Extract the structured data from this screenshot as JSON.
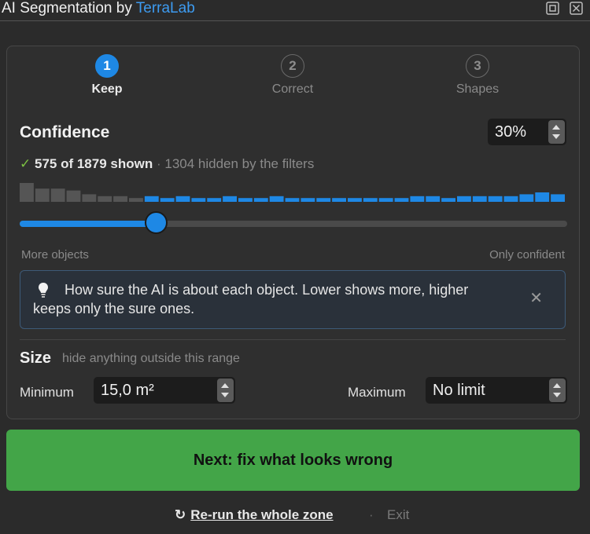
{
  "window": {
    "title_prefix": "AI Segmentation by ",
    "title_brand": "TerraLab"
  },
  "steps": [
    {
      "number": "1",
      "label": "Keep",
      "active": true
    },
    {
      "number": "2",
      "label": "Correct",
      "active": false
    },
    {
      "number": "3",
      "label": "Shapes",
      "active": false
    }
  ],
  "confidence": {
    "title": "Confidence",
    "value": "30%",
    "check": "✓",
    "shown": "575 of 1879 shown",
    "separator": "·",
    "hidden": "1304 hidden by the filters",
    "slider_fraction": 0.25,
    "min_label": "More objects",
    "max_label": "Only confident",
    "histogram": {
      "bins": [
        10,
        7,
        7,
        6,
        4,
        3,
        3,
        2,
        3,
        2,
        3,
        2,
        2,
        3,
        2,
        2,
        3,
        2,
        2,
        2,
        2,
        2,
        2,
        2,
        2,
        3,
        3,
        2,
        3,
        3,
        3,
        3,
        4,
        5,
        4
      ],
      "active_from_bin": 8,
      "hidden_color": "#555555",
      "active_color": "#1e88e5"
    }
  },
  "info": {
    "text": "How sure the AI is about each object. Lower shows more, higher keeps only the sure ones.",
    "close": "✕"
  },
  "size": {
    "title": "Size",
    "hint": "hide anything outside this range",
    "min_label": "Minimum",
    "min_value": "15,0 m²",
    "max_label": "Maximum",
    "max_value": "No limit"
  },
  "actions": {
    "next": "Next: fix what looks wrong",
    "rerun_icon": "↻",
    "rerun": "Re-run the whole zone",
    "separator": "·",
    "exit": "Exit"
  },
  "colors": {
    "accent": "#1e88e5",
    "brand": "#3d9bf0",
    "primary_button": "#43a548",
    "check": "#7cc142"
  }
}
